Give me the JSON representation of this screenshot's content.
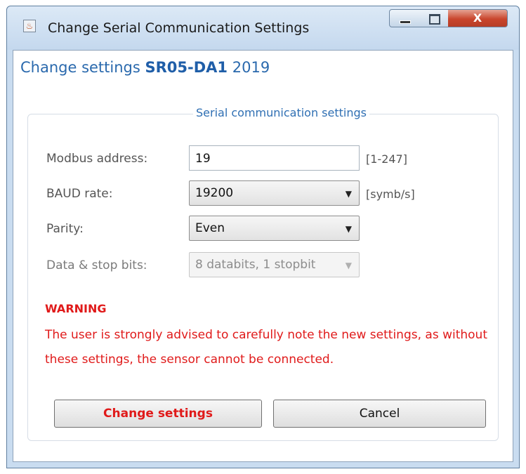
{
  "window": {
    "title": "Change Serial Communication Settings",
    "app_icon": "java-app-icon",
    "controls": {
      "minimize": "minimize-icon",
      "maximize": "maximize-icon",
      "close_glyph": "X"
    }
  },
  "header": {
    "prefix": "Change settings",
    "model": "SR05-DA1",
    "serial": "2019"
  },
  "group": {
    "legend": "Serial communication settings",
    "fields": {
      "modbus": {
        "label": "Modbus address:",
        "value": "19",
        "hint": "[1-247]"
      },
      "baud": {
        "label": "BAUD rate:",
        "value": "19200",
        "hint": "[symb/s]"
      },
      "parity": {
        "label": "Parity:",
        "value": "Even"
      },
      "databits": {
        "label": "Data & stop bits:",
        "value": "8 databits, 1 stopbit"
      }
    },
    "warning": {
      "title": "WARNING",
      "text": "The user is strongly advised to carefully note the new settings, as without these settings, the sensor cannot be connected."
    },
    "buttons": {
      "change": "Change settings",
      "cancel": "Cancel"
    }
  },
  "colors": {
    "accent_blue": "#2a69ad",
    "warning_red": "#e01a1a"
  }
}
